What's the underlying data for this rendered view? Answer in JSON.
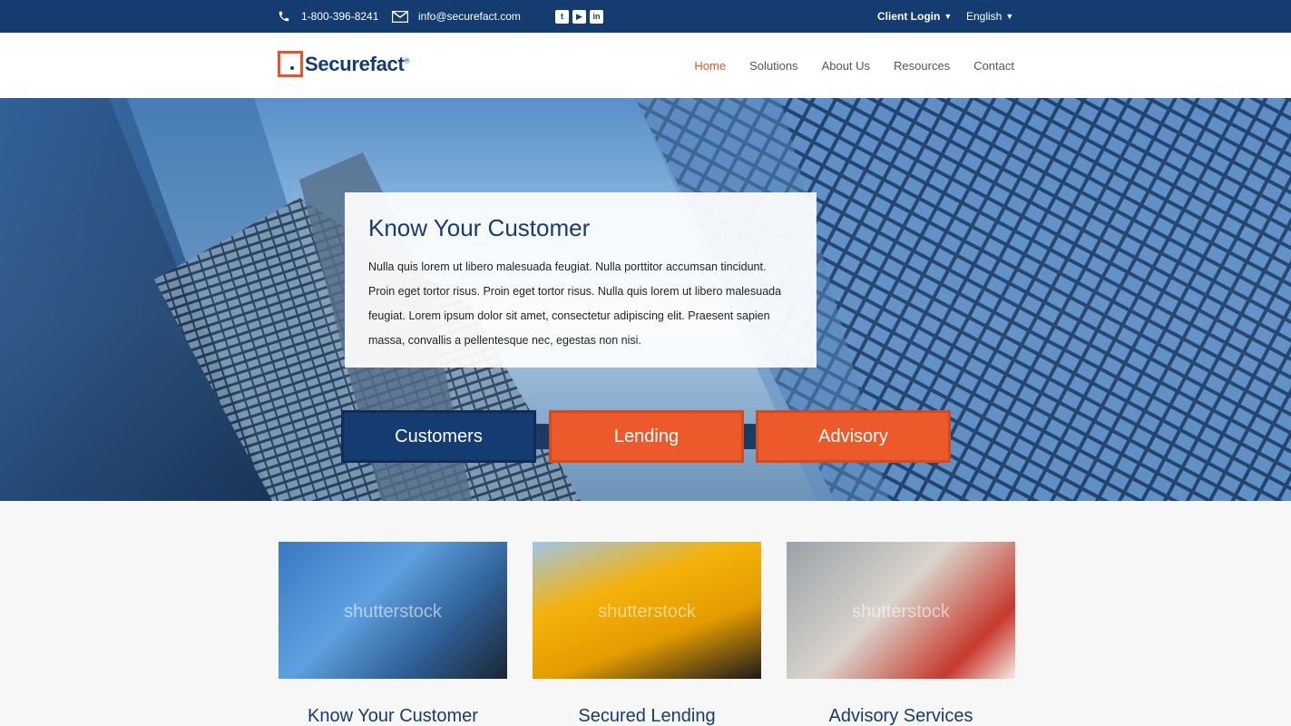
{
  "topbar": {
    "phone": "1-800-396-8241",
    "email": "info@securefact.com",
    "social": [
      {
        "name": "twitter-icon",
        "glyph": "t"
      },
      {
        "name": "youtube-icon",
        "glyph": "▶"
      },
      {
        "name": "linkedin-icon",
        "glyph": "in"
      }
    ],
    "client_login": "Client Login",
    "language": "English"
  },
  "brand": {
    "logo_text": "Securefact",
    "reg": "®",
    "accent": "#e8542a",
    "primary": "#143c70"
  },
  "nav": {
    "items": [
      "Home",
      "Solutions",
      "About Us",
      "Resources",
      "Contact"
    ],
    "active": "Home"
  },
  "hero": {
    "title": "Know Your Customer",
    "body": "Nulla quis lorem ut libero malesuada feugiat. Nulla porttitor accumsan tincidunt. Proin eget tortor risus. Proin eget tortor risus. Nulla quis lorem ut libero malesuada feugiat. Lorem ipsum dolor sit amet, consectetur adipiscing elit. Praesent sapien massa, convallis a pellentesque nec, egestas non nisi.",
    "buttons": [
      "Customers",
      "Lending",
      "Advisory"
    ]
  },
  "cards": [
    {
      "title": "Know Your Customer",
      "watermark": "shutterstock"
    },
    {
      "title": "Secured Lending",
      "watermark": "shutterstock"
    },
    {
      "title": "Advisory Services",
      "watermark": "shutterstock"
    }
  ]
}
